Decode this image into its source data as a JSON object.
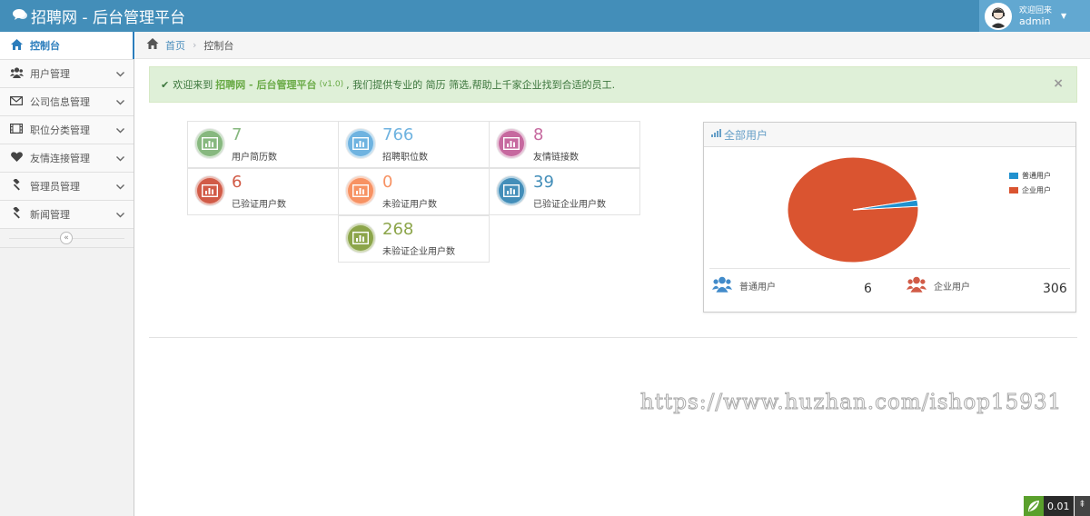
{
  "navbar": {
    "title": "招聘网 - 后台管理平台",
    "user": {
      "welcome": "欢迎回来",
      "name": "admin"
    }
  },
  "sidebar": {
    "items": [
      {
        "label": "控制台",
        "icon": "home-icon",
        "active": true
      },
      {
        "label": "用户管理",
        "icon": "users-icon"
      },
      {
        "label": "公司信息管理",
        "icon": "envelope-icon"
      },
      {
        "label": "职位分类管理",
        "icon": "film-icon"
      },
      {
        "label": "友情连接管理",
        "icon": "heart-icon"
      },
      {
        "label": "管理员管理",
        "icon": "gavel-icon"
      },
      {
        "label": "新闻管理",
        "icon": "gavel-icon"
      }
    ]
  },
  "breadcrumb": {
    "home": "首页",
    "current": "控制台"
  },
  "alert": {
    "prefix": "欢迎来到",
    "brand": "招聘网 - 后台管理平台",
    "version": "(v1.0)",
    "suffix": ", 我们提供专业的 简历 筛选,帮助上千家企业找到合适的员工."
  },
  "stats": [
    {
      "value": "7",
      "label": "用户简历数",
      "color": "#87b87f"
    },
    {
      "value": "766",
      "label": "招聘职位数",
      "color": "#6fb3e0"
    },
    {
      "value": "8",
      "label": "友情链接数",
      "color": "#c6699f"
    },
    {
      "value": "6",
      "label": "已验证用户数",
      "color": "#d15b47"
    },
    {
      "value": "0",
      "label": "未验证用户数",
      "color": "#f79263"
    },
    {
      "value": "39",
      "label": "已验证企业用户数",
      "color": "#438eb9"
    },
    {
      "value": "268",
      "label": "未验证企业用户数",
      "color": "#8ca54a"
    }
  ],
  "chart_panel": {
    "title": "全部用户",
    "footer": [
      {
        "label": "普通用户",
        "value": "6",
        "color": "#428bca"
      },
      {
        "label": "企业用户",
        "value": "306",
        "color": "#d15b47"
      }
    ]
  },
  "chart_data": {
    "type": "pie",
    "categories": [
      "普通用户",
      "企业用户"
    ],
    "values": [
      6,
      306
    ],
    "colors": [
      "#2091cf",
      "#da5430"
    ],
    "legend_position": "top-right"
  },
  "watermark": "https://www.huzhan.com/ishop15931",
  "corner_widget": {
    "text": "0.01"
  }
}
